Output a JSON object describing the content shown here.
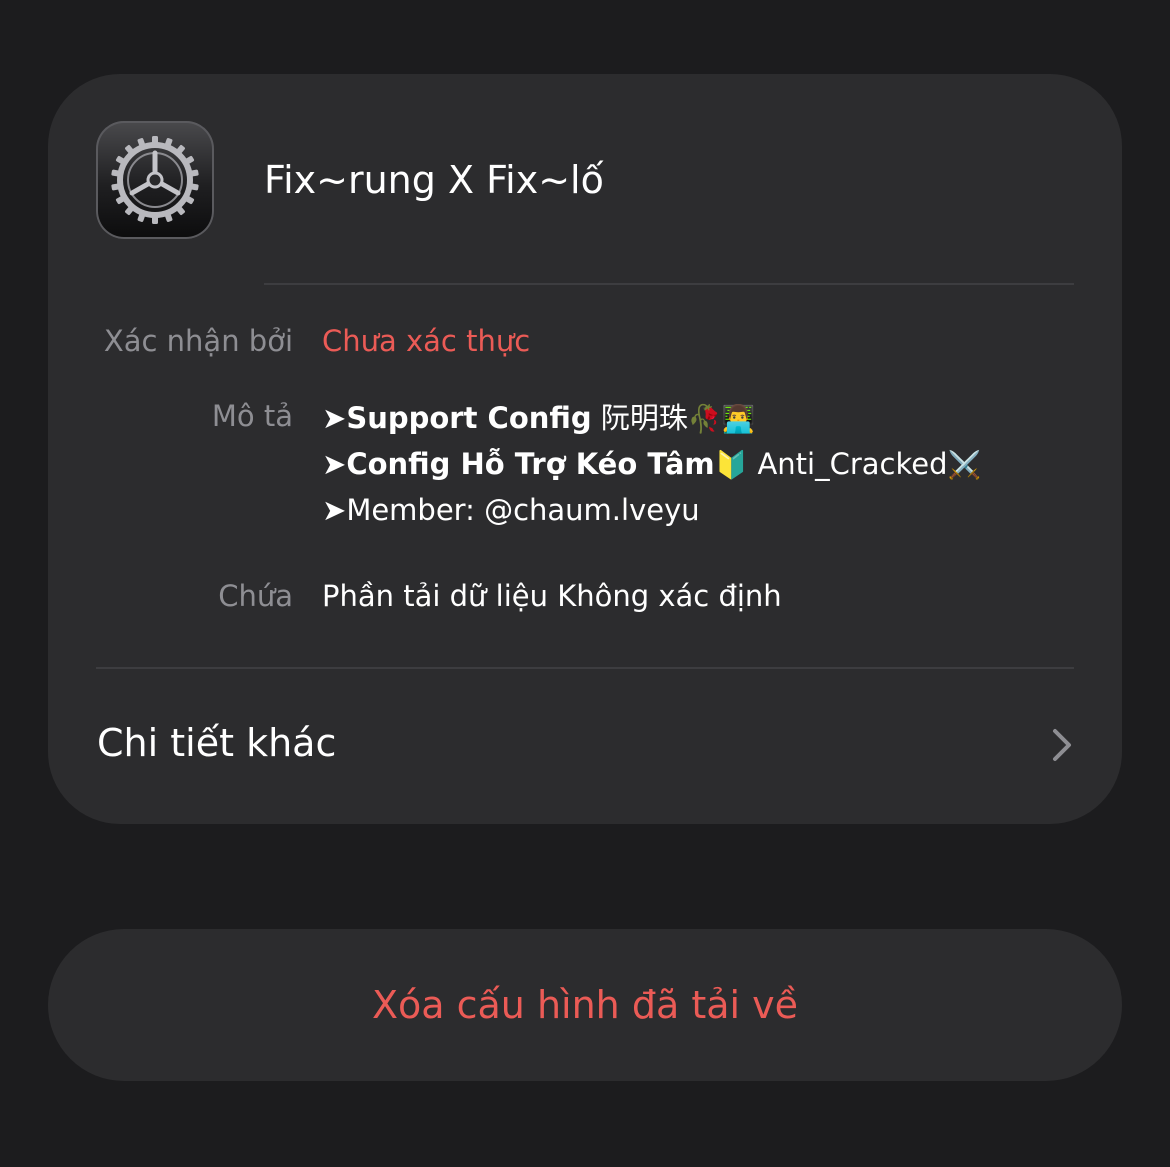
{
  "profile": {
    "icon": "settings-gear-icon",
    "title": "Fix~rung X Fix~lố"
  },
  "details": {
    "verified_by_label": "Xác nhận bởi",
    "verified_by_value": "Chưa xác thực",
    "description_label": "Mô tả",
    "description_lines": [
      {
        "arrow": "➤",
        "bold": "Support Config",
        "rest": " 阮明珠",
        "emoji": "🥀👨‍💻"
      },
      {
        "arrow": "➤",
        "bold": "Config Hỗ Trợ Kéo Tâm",
        "emoji": "🔰",
        "rest": "  Anti_Cracked",
        "emoji2": "⚔️"
      },
      {
        "arrow": "➤",
        "bold": "",
        "rest": "Member: @chaum.lveyu"
      }
    ],
    "contains_label": "Chứa",
    "contains_value": "Phần tải dữ liệu Không xác định"
  },
  "more_details": {
    "label": "Chi tiết khác",
    "icon": "chevron-right-icon"
  },
  "remove_button": {
    "label": "Xóa cấu hình đã tải về"
  },
  "colors": {
    "background": "#1c1c1e",
    "card": "#2c2c2e",
    "destructive": "#eb5b56",
    "secondary_text": "#8e8e93"
  }
}
